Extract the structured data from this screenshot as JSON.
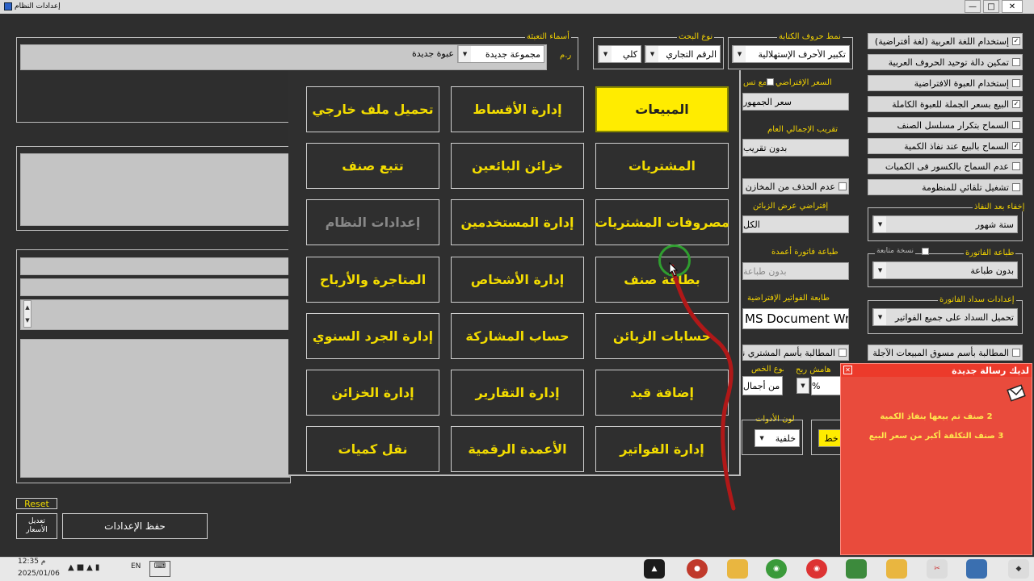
{
  "window": {
    "title": "إعدادات النظام"
  },
  "top_left": {
    "group_label": "أسماء التعبئة",
    "rm_label": "ر.م",
    "group_value": "مجموعة جديدة",
    "pack_value": "عبوة جديدة"
  },
  "search": {
    "label": "نوع البحث",
    "type_value": "الرقم التجاري",
    "mode_value": "كلي"
  },
  "letters": {
    "label": "نمط حروف الكتابة",
    "value": "تكبير الأحرف الإستهلالية"
  },
  "default_price": {
    "label": "السعر الإفتراضي",
    "with_label": "مع تس",
    "value": "سعر الجمهور"
  },
  "total_rounding": {
    "label": "تقريب الإجمالي العام",
    "value": "بدون تقريب"
  },
  "no_delete_stores": {
    "label": "عدم الحذف من المخازن",
    "checked": false
  },
  "customers_view": {
    "label": "إفتراضي عرض الزبائن",
    "value": "الكل"
  },
  "columns_print": {
    "label": "طباعة فاتورة أعمدة",
    "value": "بدون طباعة"
  },
  "invoice_printer": {
    "label": "طابعة الفواتير الإفتراضية",
    "value": "MS Document Writer"
  },
  "buyer_claim": {
    "label": "المطالبة بأسم المشتري نقد",
    "checked": false
  },
  "discount": {
    "type_label": "نوع الخص",
    "margin_label": "هامش ربح",
    "type_value": "من أجمال",
    "margin_value": "%"
  },
  "tools_color": {
    "label": "لون الأدوات",
    "value": "خلفية",
    "font_value": "خط"
  },
  "options": [
    {
      "label": "إستخدام اللغة العربية (لغة أفتراضية)",
      "checked": true
    },
    {
      "label": "تمكين دالة توحيد الحروف العربية",
      "checked": false
    },
    {
      "label": "إستخدام العبوة الافتراضية",
      "checked": false
    },
    {
      "label": "البيع بسعر الجملة للعبوة الكاملة",
      "checked": true
    },
    {
      "label": "السماح بتكرار مسلسل الصنف",
      "checked": false
    },
    {
      "label": "السماح بالبيع عند نفاذ الكمية",
      "checked": true
    },
    {
      "label": "عدم السماح بالكسور فى الكميات",
      "checked": false
    },
    {
      "label": "تشغيل تلقائي للمنظومة",
      "checked": false
    }
  ],
  "hide_after_expiry": {
    "label": "إخفاء بعد النفاذ",
    "value": "ستة شهور"
  },
  "invoice_print": {
    "label": "طباعة الفاتورة",
    "copy_label": "نسخة متابعة",
    "value": "بدون طباعة"
  },
  "invoice_payment": {
    "label": "إعدادات سداد الفاتورة",
    "value": "تحميل السداد على جميع الفواتير"
  },
  "marketer_claim": {
    "label": "المطالبة بأسم مسوق المبيعات الآجلة",
    "checked": false
  },
  "menu": {
    "items": [
      {
        "label": "المبيعات"
      },
      {
        "label": "إدارة الأقساط"
      },
      {
        "label": "تحميل ملف خارجي"
      },
      {
        "label": "المشتريات"
      },
      {
        "label": "خزائن البائعين"
      },
      {
        "label": "تتبع صنف"
      },
      {
        "label": "مصروفات المشتريات"
      },
      {
        "label": "إدارة المستخدمين"
      },
      {
        "label": "إعدادات النظام"
      },
      {
        "label": "بطاقة صنف"
      },
      {
        "label": "إدارة الأشخاص"
      },
      {
        "label": "المتاجرة والأرباح"
      },
      {
        "label": "حسابات الزبائن"
      },
      {
        "label": "حساب المشاركة"
      },
      {
        "label": "إدارة الجرد السنوي"
      },
      {
        "label": "إضافة قيد"
      },
      {
        "label": "إدارة التقارير"
      },
      {
        "label": "إدارة الخزائن"
      },
      {
        "label": "إدارة الفواتير"
      },
      {
        "label": "الأعمدة الرقمية"
      },
      {
        "label": "نقل كميات"
      }
    ]
  },
  "bottom": {
    "reset_label": "Reset",
    "edit_prices_label": "تعديل الأسعار",
    "save_label": "حفظ الإعدادات"
  },
  "notification": {
    "title": "لديك رسالة جديدة",
    "messages": [
      {
        "count": "2",
        "text": "صنف تم بيعها بنفاذ الكمية"
      },
      {
        "count": "3",
        "text": "صنف التكلفة أكبر من سعر البيع"
      }
    ]
  },
  "taskbar": {
    "time": "12:35 م",
    "date": "2025/01/06",
    "lang": "EN"
  },
  "colors": {
    "accent_yellow": "#f3dc00",
    "active_button": "#ffec00",
    "notification_bg": "#e94b3c",
    "background": "#2e2e2e"
  }
}
